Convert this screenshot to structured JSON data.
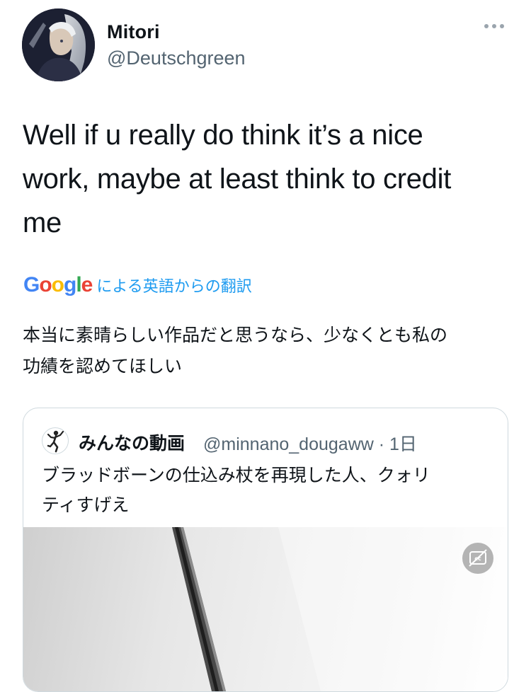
{
  "user": {
    "display_name": "Mitori",
    "handle": "@Deutschgreen"
  },
  "tweet": {
    "text_line1": "Well if u really do think it’s a nice",
    "text_line2": "work, maybe at least think to credit",
    "text_line3": "me"
  },
  "translation": {
    "provider": [
      "G",
      "o",
      "o",
      "g",
      "l",
      "e"
    ],
    "label": "による英語からの翻訳",
    "text_line1": "本当に素晴らしい作品だと思うなら、少なくとも私の",
    "text_line2": "功績を認めてほしい"
  },
  "quote": {
    "display_name": "みんなの動画",
    "meta": "@minnano_dougaww · 1日",
    "text_line1": "ブラッドボーンの仕込み杖を再現した人、クォリ",
    "text_line2": "ティすげえ"
  },
  "icons": {
    "more": "more-horizontal-icon",
    "captions": "closed-captions-off-icon"
  },
  "colors": {
    "link_blue": "#1d9bf0",
    "secondary_text": "#536471",
    "border": "#cfd9de"
  }
}
